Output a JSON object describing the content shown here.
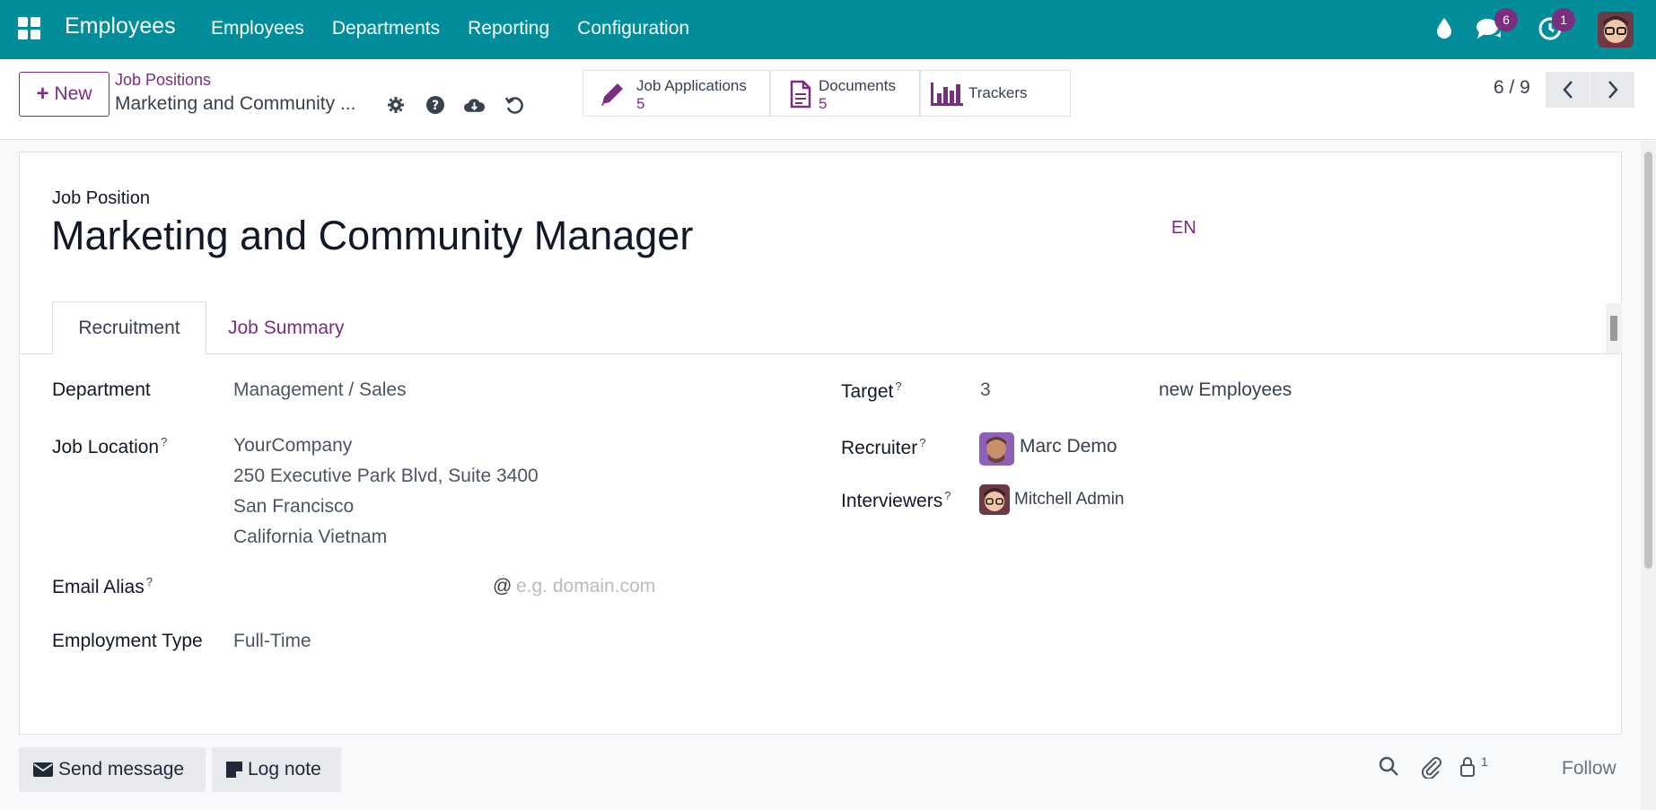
{
  "navbar": {
    "app_title": "Employees",
    "menu": [
      "Employees",
      "Departments",
      "Reporting",
      "Configuration"
    ],
    "messages_badge": "6",
    "activities_badge": "1",
    "accent": "#018d9a"
  },
  "control_panel": {
    "new_label": "New",
    "breadcrumb": "Job Positions",
    "record_name": "Marketing and Community ...",
    "smart_buttons": [
      {
        "label": "Job Applications",
        "count": "5",
        "icon": "pencil-icon"
      },
      {
        "label": "Documents",
        "count": "5",
        "icon": "document-icon"
      },
      {
        "label": "Trackers",
        "count": "",
        "icon": "bar-chart-icon"
      }
    ],
    "pager": "6 / 9"
  },
  "form": {
    "label": "Job Position",
    "title": "Marketing and Community Manager",
    "lang": "EN",
    "tabs": [
      "Recruitment",
      "Job Summary"
    ],
    "fields": {
      "department": {
        "label": "Department",
        "value": "Management / Sales"
      },
      "job_location": {
        "label": "Job Location",
        "lines": [
          "YourCompany",
          "250 Executive Park Blvd, Suite 3400",
          "San Francisco",
          "California Vietnam"
        ]
      },
      "email_alias": {
        "label": "Email Alias",
        "at": "@",
        "placeholder": "e.g. domain.com"
      },
      "employment_type": {
        "label": "Employment Type",
        "value": "Full-Time"
      },
      "target": {
        "label": "Target",
        "value": "3",
        "suffix": "new Employees"
      },
      "recruiter": {
        "label": "Recruiter",
        "value": "Marc Demo"
      },
      "interviewers": {
        "label": "Interviewers",
        "value": "Mitchell Admin"
      }
    },
    "help_mark": "?"
  },
  "chatter": {
    "send_message": "Send message",
    "log_note": "Log note",
    "followers_count": "1",
    "follow": "Follow"
  }
}
